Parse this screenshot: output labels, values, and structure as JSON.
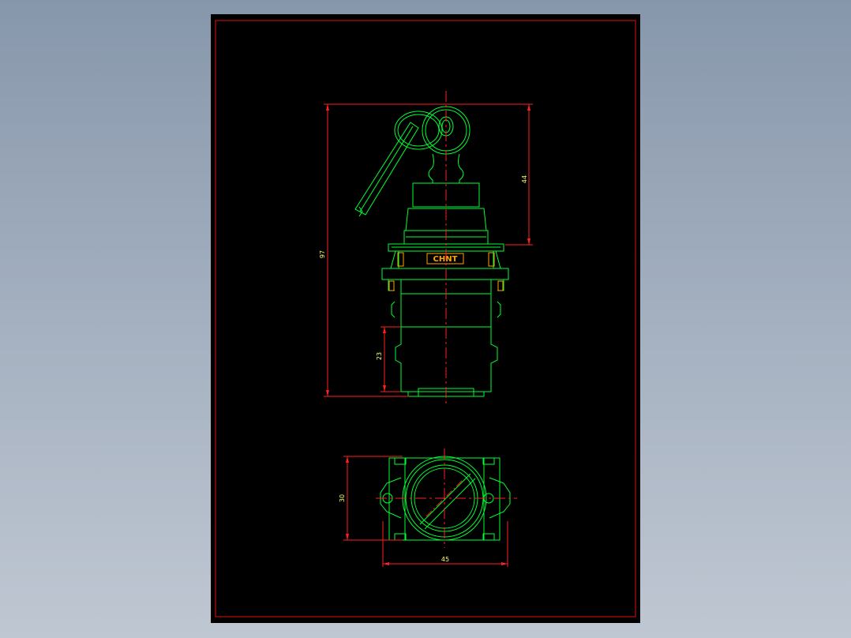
{
  "colors": {
    "background": "#8fa0b5",
    "sheet": "#000000",
    "frame": "#e01010",
    "outline": "#00ff33",
    "centerline": "#ff2020",
    "dimension_line": "#ff2020",
    "dimension_text": "#ffff66",
    "logo": "#ffa500"
  },
  "drawing": {
    "brand_label": "CHNT",
    "dimensions": {
      "total_height": "97",
      "top_height": "44",
      "bottom_height": "23",
      "bottom_view_height": "30",
      "bottom_view_width": "45"
    }
  }
}
